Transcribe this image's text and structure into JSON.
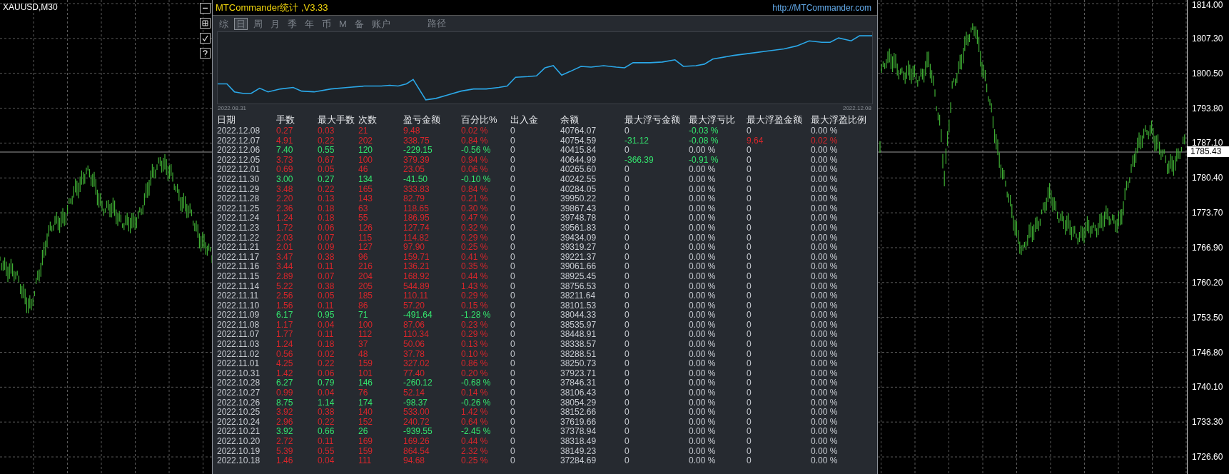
{
  "chart": {
    "symbol": "XAUUSD,M30",
    "price_axis": [
      "1814.00",
      "1807.30",
      "1800.50",
      "1793.80",
      "1787.10",
      "1780.40",
      "1773.70",
      "1766.90",
      "1760.20",
      "1753.50",
      "1746.80",
      "1740.10",
      "1733.30",
      "1726.60"
    ],
    "current_price": "1785.43"
  },
  "panel": {
    "title": "MTCommander统计 ,V3.33",
    "link": "http://MTCommander.com",
    "tabs": [
      {
        "label": "综",
        "selected": false
      },
      {
        "label": "日",
        "selected": true
      },
      {
        "label": "周",
        "selected": false
      },
      {
        "label": "月",
        "selected": false
      },
      {
        "label": "季",
        "selected": false
      },
      {
        "label": "年",
        "selected": false
      },
      {
        "label": "币",
        "selected": false
      },
      {
        "label": "M",
        "selected": false
      },
      {
        "label": "备",
        "selected": false
      },
      {
        "label": "账户",
        "selected": false
      }
    ],
    "path_label": "路径",
    "equity": {
      "start_label": "2022.08.31",
      "end_label": "2022.12.08"
    },
    "columns": [
      "日期",
      "手数",
      "最大手数",
      "次数",
      "盈亏金额",
      "百分比%",
      "出入金",
      "余额",
      "最大浮亏金额",
      "最大浮亏比",
      "最大浮盈金额",
      "最大浮盈比例"
    ],
    "rows": [
      {
        "date": "2022.12.08",
        "profit": true,
        "values": [
          "0.27",
          "0.03",
          "21",
          "9.48",
          "0.02 %"
        ],
        "flow": "0",
        "balance": "40764.07",
        "float": [
          {
            "text": "0",
            "color": "#c9cdd3"
          },
          {
            "text": "-0.03 %",
            "color": "#34e56e"
          },
          {
            "text": "0",
            "color": "#c9cdd3"
          },
          {
            "text": "0.00 %",
            "color": "#c9cdd3"
          }
        ]
      },
      {
        "date": "2022.12.07",
        "profit": true,
        "values": [
          "4.91",
          "0.22",
          "202",
          "338.75",
          "0.84 %"
        ],
        "flow": "0",
        "balance": "40754.59",
        "float": [
          {
            "text": "-31.12",
            "color": "#34e56e"
          },
          {
            "text": "-0.08 %",
            "color": "#34e56e"
          },
          {
            "text": "9.64",
            "color": "#d8262b"
          },
          {
            "text": "0.02 %",
            "color": "#d8262b"
          }
        ]
      },
      {
        "date": "2022.12.06",
        "profit": false,
        "values": [
          "7.40",
          "0.55",
          "120",
          "-229.15",
          "-0.56 %"
        ],
        "flow": "0",
        "balance": "40415.84",
        "float": [
          "0",
          "0.00 %",
          "0",
          "0.00 %"
        ]
      },
      {
        "date": "2022.12.05",
        "profit": true,
        "values": [
          "3.73",
          "0.67",
          "100",
          "379.39",
          "0.94 %"
        ],
        "flow": "0",
        "balance": "40644.99",
        "float": [
          {
            "text": "-366.39",
            "color": "#34e56e"
          },
          {
            "text": "-0.91 %",
            "color": "#34e56e"
          },
          {
            "text": "0",
            "color": "#c9cdd3"
          },
          {
            "text": "0.00 %",
            "color": "#c9cdd3"
          }
        ]
      },
      {
        "date": "2022.12.01",
        "profit": true,
        "values": [
          "0.69",
          "0.05",
          "46",
          "23.05",
          "0.06 %"
        ],
        "flow": "0",
        "balance": "40265.60",
        "float": [
          "0",
          "0.00 %",
          "0",
          "0.00 %"
        ]
      },
      {
        "date": "2022.11.30",
        "profit": false,
        "values": [
          "3.00",
          "0.27",
          "134",
          "-41.50",
          "-0.10 %"
        ],
        "flow": "0",
        "balance": "40242.55",
        "float": [
          "0",
          "0.00 %",
          "0",
          "0.00 %"
        ]
      },
      {
        "date": "2022.11.29",
        "profit": true,
        "values": [
          "3.48",
          "0.22",
          "165",
          "333.83",
          "0.84 %"
        ],
        "flow": "0",
        "balance": "40284.05",
        "float": [
          "0",
          "0.00 %",
          "0",
          "0.00 %"
        ]
      },
      {
        "date": "2022.11.28",
        "profit": true,
        "values": [
          "2.20",
          "0.13",
          "143",
          "82.79",
          "0.21 %"
        ],
        "flow": "0",
        "balance": "39950.22",
        "float": [
          "0",
          "0.00 %",
          "0",
          "0.00 %"
        ]
      },
      {
        "date": "2022.11.25",
        "profit": true,
        "values": [
          "2.36",
          "0.18",
          "63",
          "118.65",
          "0.30 %"
        ],
        "flow": "0",
        "balance": "39867.43",
        "float": [
          "0",
          "0.00 %",
          "0",
          "0.00 %"
        ]
      },
      {
        "date": "2022.11.24",
        "profit": true,
        "values": [
          "1.24",
          "0.18",
          "55",
          "186.95",
          "0.47 %"
        ],
        "flow": "0",
        "balance": "39748.78",
        "float": [
          "0",
          "0.00 %",
          "0",
          "0.00 %"
        ]
      },
      {
        "date": "2022.11.23",
        "profit": true,
        "values": [
          "1.72",
          "0.06",
          "126",
          "127.74",
          "0.32 %"
        ],
        "flow": "0",
        "balance": "39561.83",
        "float": [
          "0",
          "0.00 %",
          "0",
          "0.00 %"
        ]
      },
      {
        "date": "2022.11.22",
        "profit": true,
        "values": [
          "2.03",
          "0.07",
          "115",
          "114.82",
          "0.29 %"
        ],
        "flow": "0",
        "balance": "39434.09",
        "float": [
          "0",
          "0.00 %",
          "0",
          "0.00 %"
        ]
      },
      {
        "date": "2022.11.21",
        "profit": true,
        "values": [
          "2.01",
          "0.09",
          "127",
          "97.90",
          "0.25 %"
        ],
        "flow": "0",
        "balance": "39319.27",
        "float": [
          "0",
          "0.00 %",
          "0",
          "0.00 %"
        ]
      },
      {
        "date": "2022.11.17",
        "profit": true,
        "values": [
          "3.47",
          "0.38",
          "96",
          "159.71",
          "0.41 %"
        ],
        "flow": "0",
        "balance": "39221.37",
        "float": [
          "0",
          "0.00 %",
          "0",
          "0.00 %"
        ]
      },
      {
        "date": "2022.11.16",
        "profit": true,
        "values": [
          "3.44",
          "0.11",
          "216",
          "136.21",
          "0.35 %"
        ],
        "flow": "0",
        "balance": "39061.66",
        "float": [
          "0",
          "0.00 %",
          "0",
          "0.00 %"
        ]
      },
      {
        "date": "2022.11.15",
        "profit": true,
        "values": [
          "2.89",
          "0.07",
          "204",
          "168.92",
          "0.44 %"
        ],
        "flow": "0",
        "balance": "38925.45",
        "float": [
          "0",
          "0.00 %",
          "0",
          "0.00 %"
        ]
      },
      {
        "date": "2022.11.14",
        "profit": true,
        "values": [
          "5.22",
          "0.38",
          "205",
          "544.89",
          "1.43 %"
        ],
        "flow": "0",
        "balance": "38756.53",
        "float": [
          "0",
          "0.00 %",
          "0",
          "0.00 %"
        ]
      },
      {
        "date": "2022.11.11",
        "profit": true,
        "values": [
          "2.56",
          "0.05",
          "185",
          "110.11",
          "0.29 %"
        ],
        "flow": "0",
        "balance": "38211.64",
        "float": [
          "0",
          "0.00 %",
          "0",
          "0.00 %"
        ]
      },
      {
        "date": "2022.11.10",
        "profit": true,
        "values": [
          "1.56",
          "0.11",
          "86",
          "57.20",
          "0.15 %"
        ],
        "flow": "0",
        "balance": "38101.53",
        "float": [
          "0",
          "0.00 %",
          "0",
          "0.00 %"
        ]
      },
      {
        "date": "2022.11.09",
        "profit": false,
        "values": [
          "6.17",
          "0.95",
          "71",
          "-491.64",
          "-1.28 %"
        ],
        "flow": "0",
        "balance": "38044.33",
        "float": [
          "0",
          "0.00 %",
          "0",
          "0.00 %"
        ]
      },
      {
        "date": "2022.11.08",
        "profit": true,
        "values": [
          "1.17",
          "0.04",
          "100",
          "87.06",
          "0.23 %"
        ],
        "flow": "0",
        "balance": "38535.97",
        "float": [
          "0",
          "0.00 %",
          "0",
          "0.00 %"
        ]
      },
      {
        "date": "2022.11.07",
        "profit": true,
        "values": [
          "1.77",
          "0.11",
          "112",
          "110.34",
          "0.29 %"
        ],
        "flow": "0",
        "balance": "38448.91",
        "float": [
          "0",
          "0.00 %",
          "0",
          "0.00 %"
        ]
      },
      {
        "date": "2022.11.03",
        "profit": true,
        "values": [
          "1.24",
          "0.18",
          "37",
          "50.06",
          "0.13 %"
        ],
        "flow": "0",
        "balance": "38338.57",
        "float": [
          "0",
          "0.00 %",
          "0",
          "0.00 %"
        ]
      },
      {
        "date": "2022.11.02",
        "profit": true,
        "values": [
          "0.56",
          "0.02",
          "48",
          "37.78",
          "0.10 %"
        ],
        "flow": "0",
        "balance": "38288.51",
        "float": [
          "0",
          "0.00 %",
          "0",
          "0.00 %"
        ]
      },
      {
        "date": "2022.11.01",
        "profit": true,
        "values": [
          "4.25",
          "0.22",
          "159",
          "327.02",
          "0.86 %"
        ],
        "flow": "0",
        "balance": "38250.73",
        "float": [
          "0",
          "0.00 %",
          "0",
          "0.00 %"
        ]
      },
      {
        "date": "2022.10.31",
        "profit": true,
        "values": [
          "1.42",
          "0.06",
          "101",
          "77.40",
          "0.20 %"
        ],
        "flow": "0",
        "balance": "37923.71",
        "float": [
          "0",
          "0.00 %",
          "0",
          "0.00 %"
        ]
      },
      {
        "date": "2022.10.28",
        "profit": false,
        "values": [
          "6.27",
          "0.79",
          "146",
          "-260.12",
          "-0.68 %"
        ],
        "flow": "0",
        "balance": "37846.31",
        "float": [
          "0",
          "0.00 %",
          "0",
          "0.00 %"
        ]
      },
      {
        "date": "2022.10.27",
        "profit": true,
        "values": [
          "0.99",
          "0.04",
          "76",
          "52.14",
          "0.14 %"
        ],
        "flow": "0",
        "balance": "38106.43",
        "float": [
          "0",
          "0.00 %",
          "0",
          "0.00 %"
        ]
      },
      {
        "date": "2022.10.26",
        "profit": false,
        "values": [
          "8.75",
          "1.14",
          "174",
          "-98.37",
          "-0.26 %"
        ],
        "flow": "0",
        "balance": "38054.29",
        "float": [
          "0",
          "0.00 %",
          "0",
          "0.00 %"
        ]
      },
      {
        "date": "2022.10.25",
        "profit": true,
        "values": [
          "3.92",
          "0.38",
          "140",
          "533.00",
          "1.42 %"
        ],
        "flow": "0",
        "balance": "38152.66",
        "float": [
          "0",
          "0.00 %",
          "0",
          "0.00 %"
        ]
      },
      {
        "date": "2022.10.24",
        "profit": true,
        "values": [
          "2.96",
          "0.22",
          "152",
          "240.72",
          "0.64 %"
        ],
        "flow": "0",
        "balance": "37619.66",
        "float": [
          "0",
          "0.00 %",
          "0",
          "0.00 %"
        ]
      },
      {
        "date": "2022.10.21",
        "profit": false,
        "values": [
          "3.92",
          "0.66",
          "26",
          "-939.55",
          "-2.45 %"
        ],
        "flow": "0",
        "balance": "37378.94",
        "float": [
          "0",
          "0.00 %",
          "0",
          "0.00 %"
        ]
      },
      {
        "date": "2022.10.20",
        "profit": true,
        "values": [
          "2.72",
          "0.11",
          "169",
          "169.26",
          "0.44 %"
        ],
        "flow": "0",
        "balance": "38318.49",
        "float": [
          "0",
          "0.00 %",
          "0",
          "0.00 %"
        ]
      },
      {
        "date": "2022.10.19",
        "profit": true,
        "values": [
          "5.39",
          "0.55",
          "159",
          "864.54",
          "2.32 %"
        ],
        "flow": "0",
        "balance": "38149.23",
        "float": [
          "0",
          "0.00 %",
          "0",
          "0.00 %"
        ]
      },
      {
        "date": "2022.10.18",
        "profit": true,
        "values": [
          "1.46",
          "0.04",
          "111",
          "94.68",
          "0.25 %"
        ],
        "flow": "0",
        "balance": "37284.69",
        "float": [
          "0",
          "0.00 %",
          "0",
          "0.00 %"
        ]
      }
    ]
  }
}
